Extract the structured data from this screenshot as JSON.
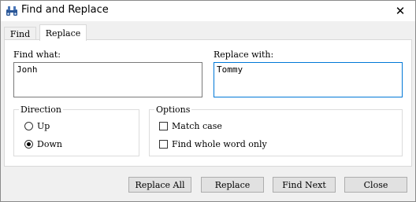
{
  "window": {
    "title": "Find and Replace",
    "close_glyph": "✕"
  },
  "tabs": [
    {
      "label": "Find",
      "active": false
    },
    {
      "label": "Replace",
      "active": true
    }
  ],
  "find": {
    "label": "Find what:",
    "value": "Jonh"
  },
  "replace": {
    "label": "Replace with:",
    "value": "Tommy"
  },
  "direction": {
    "legend": "Direction",
    "options": [
      {
        "label": "Up",
        "checked": false
      },
      {
        "label": "Down",
        "checked": true
      }
    ]
  },
  "options": {
    "legend": "Options",
    "items": [
      {
        "label": "Match case",
        "checked": false
      },
      {
        "label": "Find whole word only",
        "checked": false
      }
    ]
  },
  "buttons": {
    "replace_all": "Replace All",
    "replace": "Replace",
    "find_next": "Find Next",
    "close": "Close"
  },
  "colors": {
    "focus_border": "#0078d7",
    "icon_blue": "#2b5797"
  }
}
